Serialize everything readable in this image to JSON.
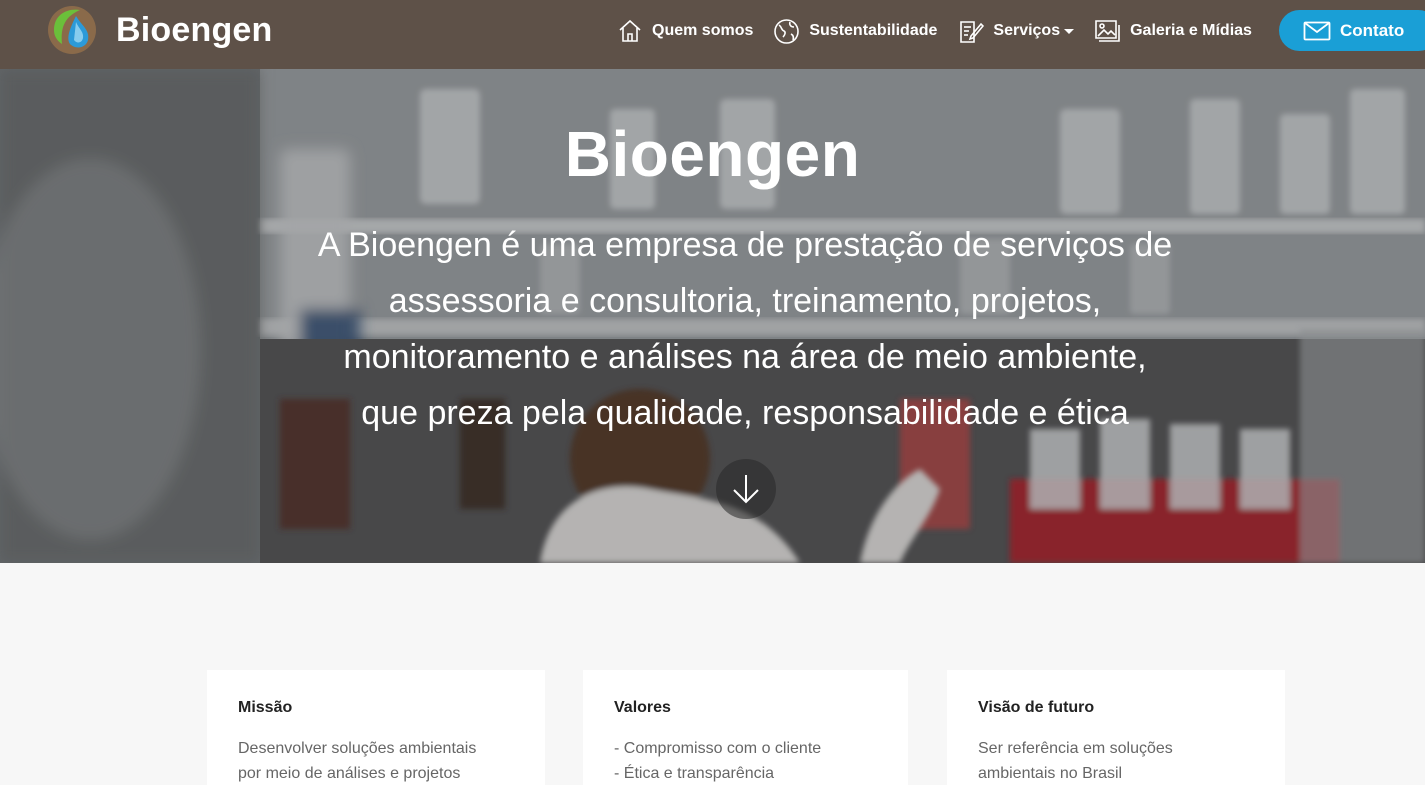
{
  "brand": {
    "name": "Bioengen"
  },
  "nav": {
    "items": [
      {
        "label": "Quem somos",
        "icon": "home-icon"
      },
      {
        "label": "Sustentabilidade",
        "icon": "globe-icon"
      },
      {
        "label": "Serviços",
        "icon": "edit-document-icon",
        "dropdown": true
      },
      {
        "label": "Galeria e Mídias",
        "icon": "gallery-icon"
      }
    ],
    "contact_label": "Contato"
  },
  "hero": {
    "title": "Bioengen",
    "lines": [
      "A Bioengen é uma empresa de prestação de serviços de",
      "assessoria e consultoria, treinamento, projetos,",
      "monitoramento e análises na área de meio ambiente,",
      "que preza pela qualidade, responsabilidade e ética"
    ]
  },
  "cards": [
    {
      "title": "Missão",
      "lines": [
        "Desenvolver soluções ambientais",
        "por meio de análises e projetos"
      ]
    },
    {
      "title": "Valores",
      "lines": [
        "- Compromisso com o cliente",
        "- Ética e transparência"
      ]
    },
    {
      "title": "Visão de futuro",
      "lines": [
        "Ser referência em soluções",
        "ambientais no Brasil"
      ]
    }
  ],
  "colors": {
    "header": "#5e5148",
    "accent": "#1a9fd6",
    "background": "#f7f7f7"
  }
}
